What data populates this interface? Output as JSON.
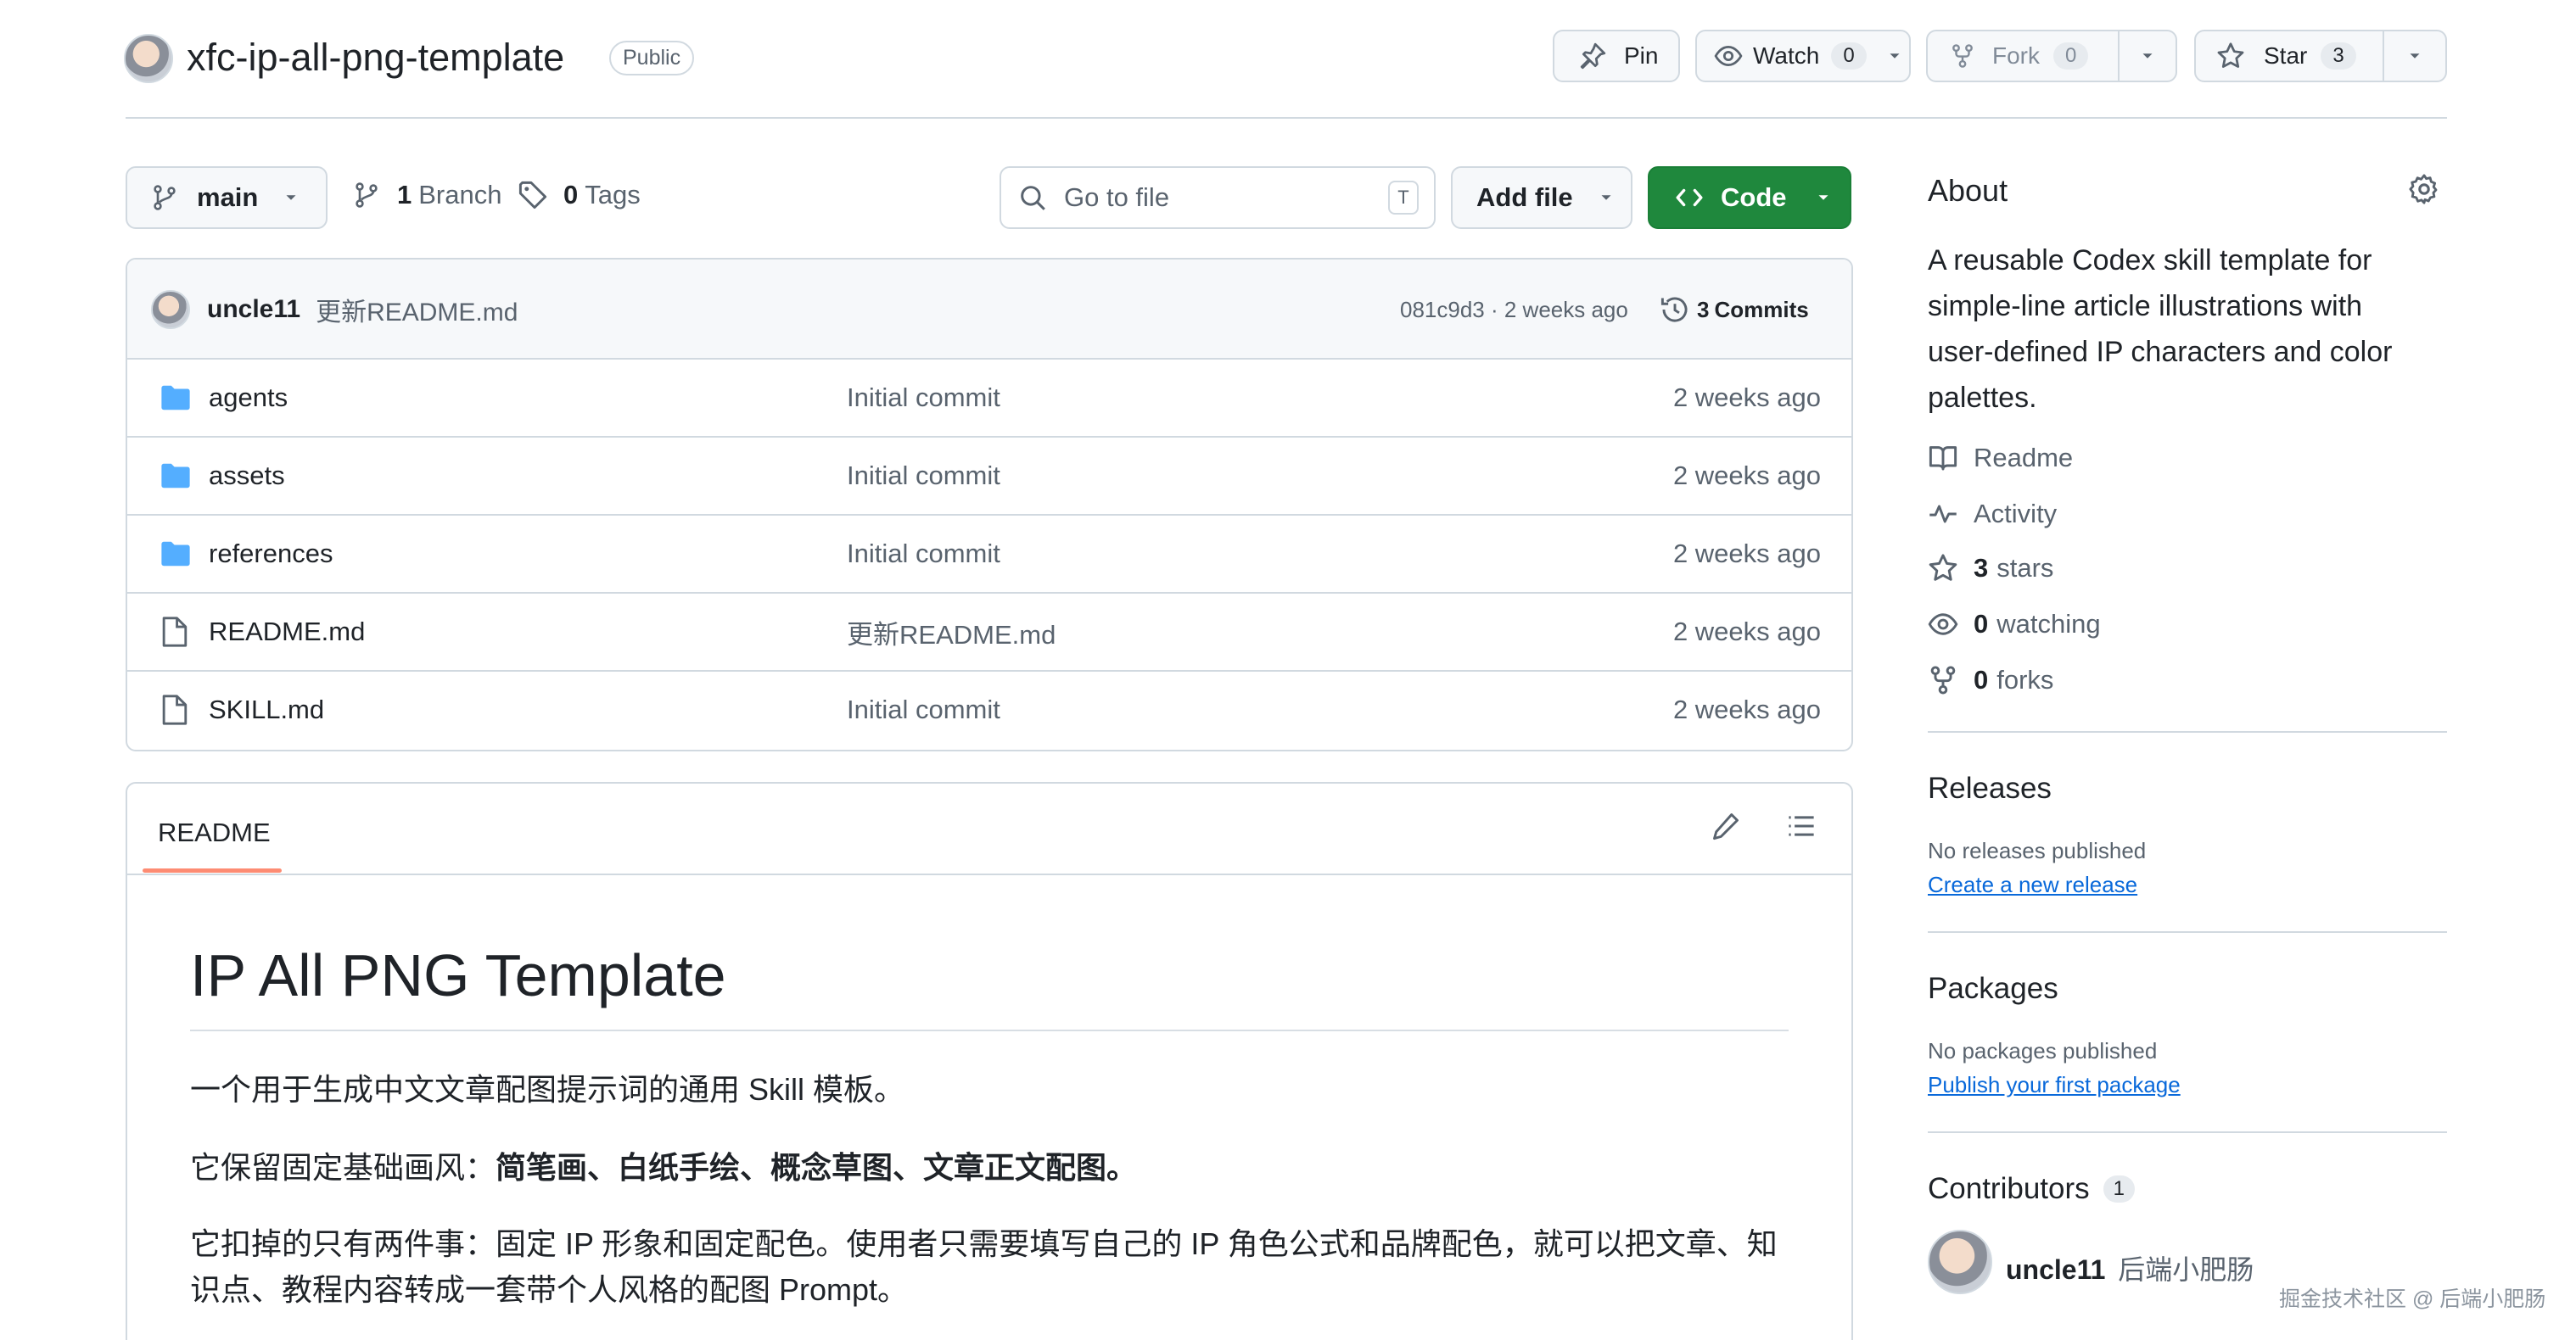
{
  "repo": {
    "name": "xfc-ip-all-png-template",
    "visibility": "Public"
  },
  "actions": {
    "pin_label": "Pin",
    "watch_label": "Watch",
    "watch_count": "0",
    "fork_label": "Fork",
    "fork_count": "0",
    "star_label": "Star",
    "star_count": "3"
  },
  "toolbar": {
    "branch_name": "main",
    "branches_count": "1",
    "branches_label": "Branch",
    "tags_count": "0",
    "tags_label": "Tags",
    "goto_placeholder": "Go to file",
    "goto_shortcut": "T",
    "add_file_label": "Add file",
    "code_label": "Code"
  },
  "latest_commit": {
    "author": "uncle11",
    "message": "更新README.md",
    "meta": "081c9d3 · 2 weeks ago",
    "commits_count": "3",
    "commits_label": "Commits"
  },
  "files": [
    {
      "type": "folder",
      "name": "agents",
      "message": "Initial commit",
      "time": "2 weeks ago"
    },
    {
      "type": "folder",
      "name": "assets",
      "message": "Initial commit",
      "time": "2 weeks ago"
    },
    {
      "type": "folder",
      "name": "references",
      "message": "Initial commit",
      "time": "2 weeks ago"
    },
    {
      "type": "file",
      "name": "README.md",
      "message": "更新README.md",
      "time": "2 weeks ago"
    },
    {
      "type": "file",
      "name": "SKILL.md",
      "message": "Initial commit",
      "time": "2 weeks ago"
    }
  ],
  "readme": {
    "tab_label": "README",
    "title": "IP All PNG Template",
    "p1": "一个用于生成中文文章配图提示词的通用 Skill 模板。",
    "p2_prefix": "它保留固定基础画风：",
    "p2_bold": "简笔画、白纸手绘、概念草图、文章正文配图。",
    "p3_line1": "它扣掉的只有两件事：固定 IP 形象和固定配色。使用者只需要填写自己的 IP 角色公式和品牌配色，就可以把文章、知",
    "p3_line2": "识点、教程内容转成一套带个人风格的配图 Prompt。"
  },
  "about": {
    "heading": "About",
    "description_lines": [
      "A reusable Codex skill template for",
      "simple-line article illustrations with",
      "user-defined IP characters and color",
      "palettes."
    ],
    "readme_label": "Readme",
    "activity_label": "Activity",
    "stars_count": "3",
    "stars_label": "stars",
    "watching_count": "0",
    "watching_label": "watching",
    "forks_count": "0",
    "forks_label": "forks"
  },
  "releases": {
    "heading": "Releases",
    "empty_text": "No releases published",
    "link": "Create a new release"
  },
  "packages": {
    "heading": "Packages",
    "empty_text": "No packages published",
    "link": "Publish your first package"
  },
  "contributors": {
    "heading": "Contributors",
    "count": "1",
    "name": "uncle11",
    "alias": "后端小肥肠"
  },
  "watermark": "掘金技术社区 @ 后端小肥肠",
  "colors": {
    "code_green": "#1f883d",
    "link_blue": "#0969da",
    "folder_blue": "#54aeff",
    "tab_underline": "#fd8c73"
  }
}
